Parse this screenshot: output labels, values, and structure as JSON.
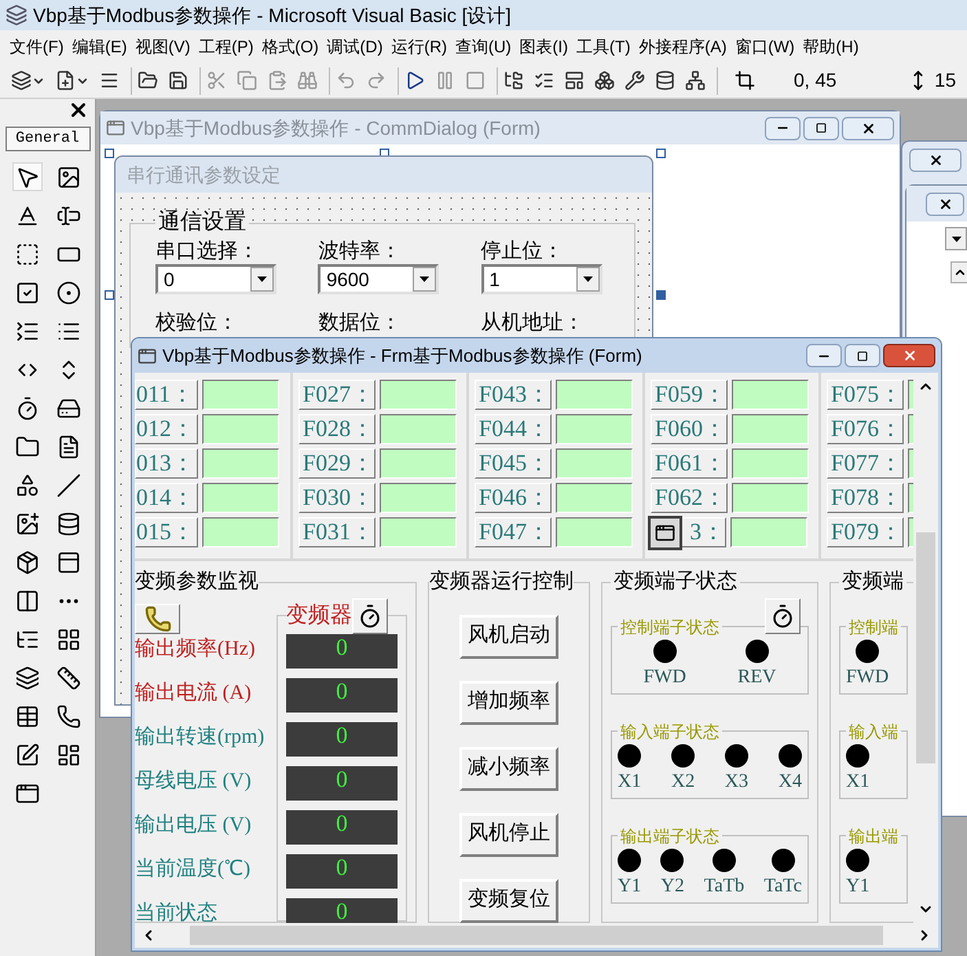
{
  "app": {
    "title": "Vbp基于Modbus参数操作 - Microsoft Visual Basic [设计]",
    "menu": [
      "文件(F)",
      "编辑(E)",
      "视图(V)",
      "工程(P)",
      "格式(O)",
      "调试(D)",
      "运行(R)",
      "查询(U)",
      "图表(I)",
      "工具(T)",
      "外接程序(A)",
      "窗口(W)",
      "帮助(H)"
    ],
    "position": "0, 45",
    "size": "15"
  },
  "toolbox": {
    "tab": "General"
  },
  "comm_dialog": {
    "title": "Vbp基于Modbus参数操作 - CommDialog (Form)",
    "panel_title": "串行通讯参数设定",
    "group_title": "通信设置",
    "fields": [
      {
        "label": "串口选择：",
        "value": "0"
      },
      {
        "label": "波特率：",
        "value": "9600"
      },
      {
        "label": "停止位：",
        "value": "1"
      },
      {
        "label": "校验位："
      },
      {
        "label": "数据位："
      },
      {
        "label": "从机地址："
      }
    ]
  },
  "form": {
    "title": "Vbp基于Modbus参数操作 - Frm基于Modbus参数操作 (Form)",
    "parameter_columns": [
      {
        "labels": [
          "011：",
          "012：",
          "013：",
          "014：",
          "015："
        ]
      },
      {
        "labels": [
          "F027：",
          "F028：",
          "F029：",
          "F030：",
          "F031："
        ]
      },
      {
        "labels": [
          "F043：",
          "F044：",
          "F045：",
          "F046：",
          "F047："
        ]
      },
      {
        "labels": [
          "F059：",
          "F060：",
          "F061：",
          "F062：",
          "3："
        ]
      },
      {
        "labels": [
          "F075：",
          "F076：",
          "F077：",
          "F078：",
          "F079："
        ]
      }
    ],
    "monitor": {
      "title": "变频参数监视",
      "display_title": "变频器",
      "rows": [
        {
          "label": "输出频率(Hz)",
          "value": "0",
          "color": "#c02020"
        },
        {
          "label": "输出电流 (A)",
          "value": "0",
          "color": "#c02020"
        },
        {
          "label": "输出转速(rpm)",
          "value": "0",
          "color": "#208080"
        },
        {
          "label": "母线电压 (V)",
          "value": "0",
          "color": "#208080"
        },
        {
          "label": "输出电压 (V)",
          "value": "0",
          "color": "#208080"
        },
        {
          "label": "当前温度(℃)",
          "value": "0",
          "color": "#208080"
        },
        {
          "label": "当前状态",
          "value": "0",
          "color": "#208080"
        }
      ]
    },
    "control": {
      "title": "变频器运行控制",
      "buttons": [
        "风机启动",
        "增加频率",
        "减小频率",
        "风机停止",
        "变频复位"
      ]
    },
    "terminal_panels": [
      {
        "title": "变频端子状态",
        "groups": [
          {
            "title": "控制端子状态",
            "terminals": [
              "FWD",
              "REV"
            ]
          },
          {
            "title": "输入端子状态",
            "terminals": [
              "X1",
              "X2",
              "X3",
              "X4"
            ]
          },
          {
            "title": "输出端子状态",
            "terminals": [
              "Y1",
              "Y2",
              "TaTb",
              "TaTc"
            ]
          }
        ]
      },
      {
        "title": "变频端",
        "groups": [
          {
            "title": "控制端",
            "terminals": [
              "FWD"
            ]
          },
          {
            "title": "输入端",
            "terminals": [
              "X1"
            ]
          },
          {
            "title": "输出端",
            "terminals": [
              "Y1"
            ]
          }
        ]
      }
    ]
  }
}
